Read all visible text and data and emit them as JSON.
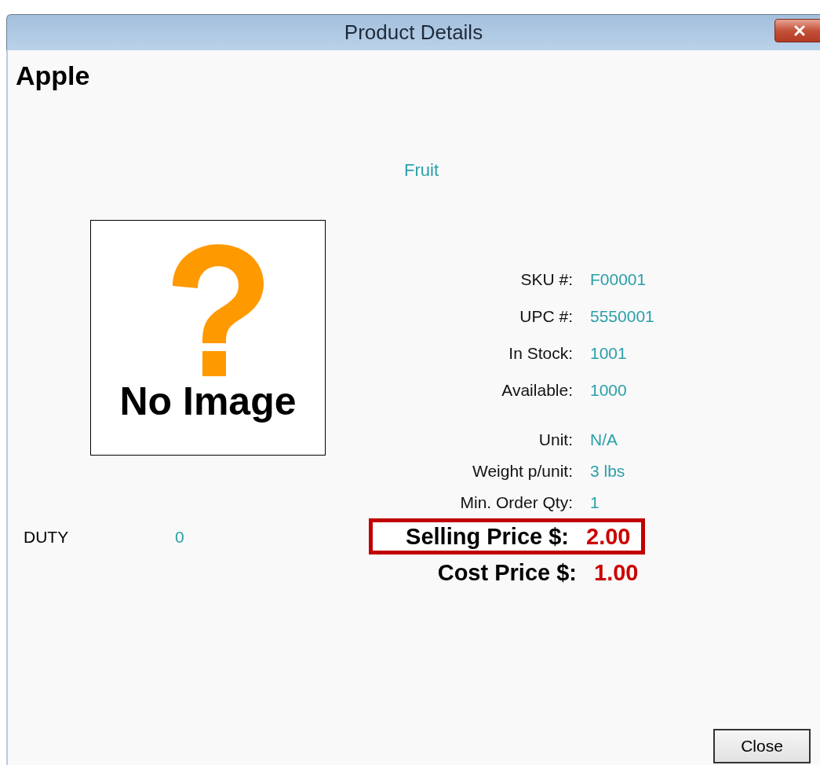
{
  "window": {
    "title": "Product Details"
  },
  "product": {
    "name": "Apple",
    "category": "Fruit"
  },
  "image": {
    "text": "No Image"
  },
  "details": [
    {
      "kind": "plain",
      "label": "SKU #:",
      "value": "F00001"
    },
    {
      "kind": "plain",
      "label": "UPC #:",
      "value": "5550001"
    },
    {
      "kind": "plain",
      "label": "In Stock:",
      "value": "1001"
    },
    {
      "kind": "plain",
      "label": "Available:",
      "value": "1000"
    },
    {
      "kind": "plain",
      "label": "Unit:",
      "value": "N/A"
    },
    {
      "kind": "plain",
      "label": "Weight p/unit:",
      "value": "3 lbs"
    },
    {
      "kind": "plain",
      "label": "Min. Order Qty:",
      "value": "1"
    },
    {
      "kind": "price",
      "label": "Selling Price $:",
      "value": "2.00",
      "highlighted": true
    },
    {
      "kind": "price",
      "label": "Cost Price $:",
      "value": "1.00",
      "highlighted": false
    }
  ],
  "duty": {
    "label": "DUTY",
    "value": "0"
  },
  "buttons": [
    "Close"
  ]
}
